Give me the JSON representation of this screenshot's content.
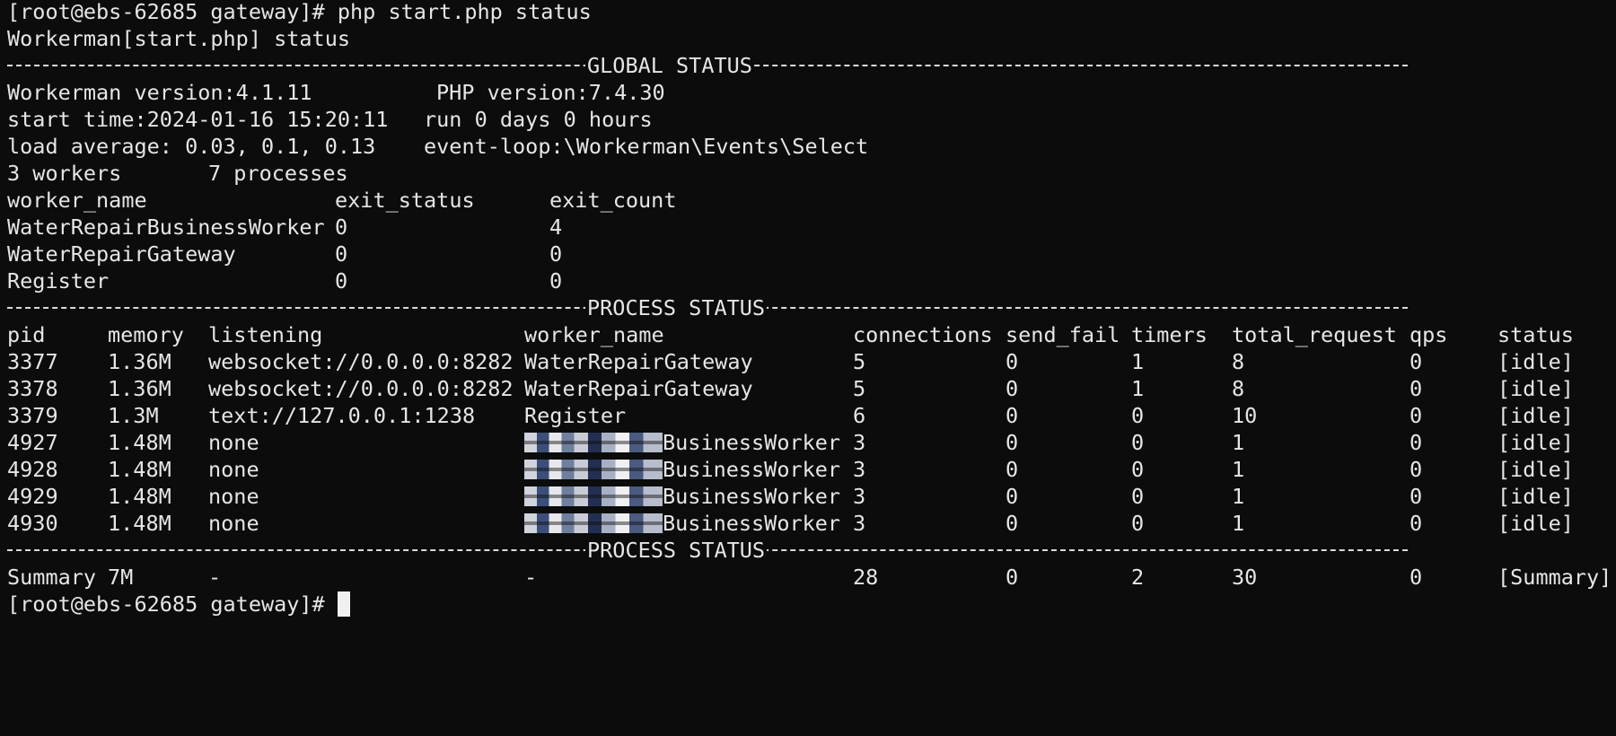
{
  "prompt": "[root@ebs-62685 gateway]# ",
  "command": "php start.php status",
  "subtitle": "Workerman[start.php] status",
  "global_title": "GLOBAL STATUS",
  "process_title": "PROCESS STATUS",
  "global": {
    "workerman_version": "Workerman version:4.1.11",
    "php_version": "PHP version:7.4.30",
    "start_time": "start time:2024-01-16 15:20:11",
    "run_time": "run 0 days 0 hours",
    "load_average": "load average: 0.03, 0.1, 0.13",
    "event_loop": "event-loop:\\Workerman\\Events\\Select",
    "workers": "3 workers",
    "processes": "7 processes"
  },
  "worker_headers": [
    "worker_name",
    "exit_status",
    "exit_count"
  ],
  "worker_rows": [
    [
      "WaterRepairBusinessWorker",
      "0",
      "4"
    ],
    [
      "WaterRepairGateway",
      "0",
      "0"
    ],
    [
      "Register",
      "0",
      "0"
    ]
  ],
  "process_headers": [
    "pid",
    "memory",
    "listening",
    "worker_name",
    "connections",
    "send_fail",
    "timers",
    "total_request",
    "qps",
    "status"
  ],
  "process_rows": [
    [
      "3377",
      "1.36M",
      "websocket://0.0.0.0:8282",
      "WaterRepairGateway",
      "5",
      "0",
      "1",
      "8",
      "0",
      "[idle]"
    ],
    [
      "3378",
      "1.36M",
      "websocket://0.0.0.0:8282",
      "WaterRepairGateway",
      "5",
      "0",
      "1",
      "8",
      "0",
      "[idle]"
    ],
    [
      "3379",
      "1.3M",
      "text://127.0.0.1:1238",
      "Register",
      "6",
      "0",
      "0",
      "10",
      "0",
      "[idle]"
    ],
    [
      "4927",
      "1.48M",
      "none",
      "BusinessWorker",
      "3",
      "0",
      "0",
      "1",
      "0",
      "[idle]"
    ],
    [
      "4928",
      "1.48M",
      "none",
      "BusinessWorker",
      "3",
      "0",
      "0",
      "1",
      "0",
      "[idle]"
    ],
    [
      "4929",
      "1.48M",
      "none",
      "BusinessWorker",
      "3",
      "0",
      "0",
      "1",
      "0",
      "[idle]"
    ],
    [
      "4930",
      "1.48M",
      "none",
      "BusinessWorker",
      "3",
      "0",
      "0",
      "1",
      "0",
      "[idle]"
    ]
  ],
  "summary_row": [
    "Summary",
    "7M",
    "-",
    "-",
    "28",
    "0",
    "2",
    "30",
    "0",
    "[Summary]"
  ],
  "final_prompt": "[root@ebs-62685 gateway]#"
}
